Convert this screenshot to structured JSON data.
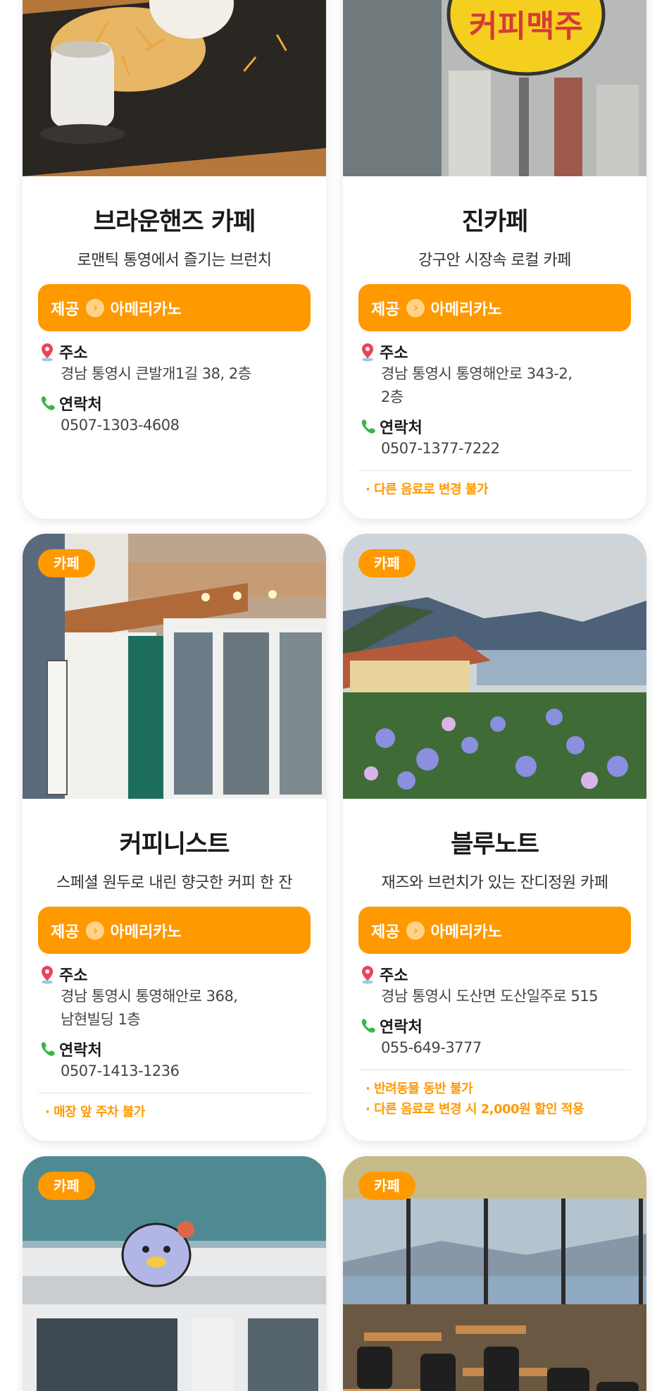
{
  "cards": [
    {
      "badge": "",
      "title": "브라운핸즈 카페",
      "subtitle": "로맨틱 통영에서 즐기는 브런치",
      "offer_prefix": "제공",
      "offer_item": "아메리카노",
      "address_label": "주소",
      "address_lines": [
        "경남 통영시 큰발개1길 38, 2층"
      ],
      "phone_label": "연락처",
      "phone": "0507-1303-4608",
      "notes": []
    },
    {
      "badge": "",
      "title": "진카페",
      "subtitle": "강구안 시장속 로컬 카페",
      "photo_sign_text": "커피맥주",
      "offer_prefix": "제공",
      "offer_item": "아메리카노",
      "address_label": "주소",
      "address_lines": [
        "경남 통영시 통영해안로 343-2,",
        "2층"
      ],
      "phone_label": "연락처",
      "phone": "0507-1377-7222",
      "notes": [
        "· 다른 음료로 변경 불가"
      ]
    },
    {
      "badge": "카페",
      "title": "커피니스트",
      "subtitle": "스페셜 원두로 내린 향긋한 커피 한 잔",
      "offer_prefix": "제공",
      "offer_item": "아메리카노",
      "address_label": "주소",
      "address_lines": [
        "경남 통영시 통영해안로 368,",
        "남현빌딩 1층"
      ],
      "phone_label": "연락처",
      "phone": "0507-1413-1236",
      "notes": [
        "· 매장 앞 주차 불가"
      ]
    },
    {
      "badge": "카페",
      "title": "블루노트",
      "subtitle": "재즈와 브런치가 있는 잔디정원 카페",
      "offer_prefix": "제공",
      "offer_item": "아메리카노",
      "address_label": "주소",
      "address_lines": [
        "경남 통영시 도산면 도산일주로 515"
      ],
      "phone_label": "연락처",
      "phone": "055-649-3777",
      "notes": [
        "· 반려동물 동반 불가",
        "· 다른 음료로 변경 시 2,000원 할인 적용"
      ]
    },
    {
      "badge": "카페"
    },
    {
      "badge": "카페"
    }
  ],
  "colors": {
    "accent": "#ff9900",
    "pin": "#e8455a",
    "phone_icon": "#3bb54a"
  },
  "icons": {
    "address": "location-pin-icon",
    "phone": "phone-icon",
    "offer": "chevron-right-icon"
  }
}
